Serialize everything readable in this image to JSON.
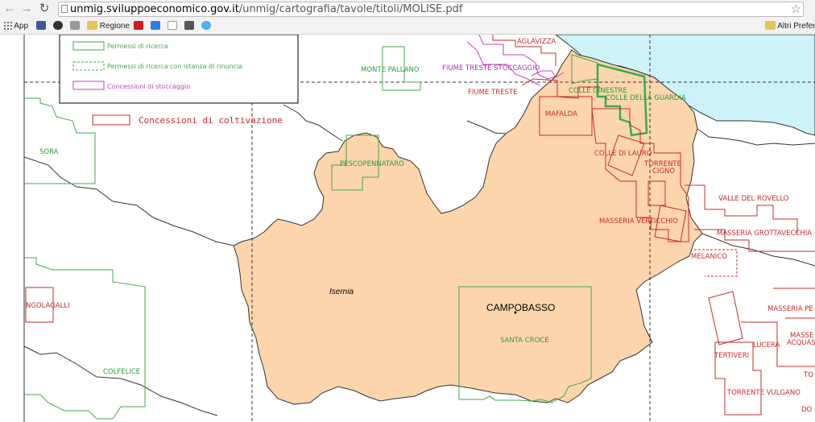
{
  "browser": {
    "url_domain": "unmig.sviluppoeconomico.gov.it",
    "url_path": "/unmig/cartografia/tavole/titoli/MOLISE.pdf",
    "bookmarks": {
      "apps_label": "App",
      "regione_label": "Regione",
      "other_label": "Altri Preferi"
    }
  },
  "legend": {
    "items": [
      "Permessi di ricerca",
      "Permessi di ricerca con istanza di rinuncia",
      "Concessioni di stoccaggio",
      "Concessioni di coltivazione"
    ]
  },
  "map": {
    "places": {
      "campobasso": "CAMPOBASSO",
      "isernia": "Isernia"
    },
    "titles": {
      "monte_pallano": "MONTE PALLANO",
      "aglavizza": "AGLAVIZZA",
      "fiume_treste_stoccaggio": "FIUME TRESTE STOCCAGGIO",
      "fiume_treste": "FIUME TRESTE",
      "colle_ginestre": "COLLE GINESTRE",
      "colle_della_guardia": "COLLE DELLA GUARDIA",
      "mafalda": "MAFALDA",
      "sora": "SORA",
      "pescopennataro": "PESCOPENNATARO",
      "colle_di_lauro": "COLLE DI LAURO",
      "torrente_cigno_1": "TORRENTE",
      "torrente_cigno_2": "CIGNO",
      "valle_del_rovello": "VALLE DEL ROVELLO",
      "masseria_verticchio": "MASSERIA VERTICCHIO",
      "masseria_grottavecchia": "MASSERIA GROTTAVECCHIA",
      "melanico": "MELANICO",
      "angolagalli": "NGOLAGALLI",
      "masseria_pe": "MASSERIA PE",
      "masse": "MASSE",
      "acqua": "ACQUAS",
      "lucera": "LUCERA",
      "tertiveri": "TERTIVERI",
      "to": "TO",
      "colfelice": "COLFELICE",
      "santa_croce": "SANTA CROCE",
      "torrente_vulgano": "TORRENTE VULGANO",
      "do": "DO"
    }
  }
}
